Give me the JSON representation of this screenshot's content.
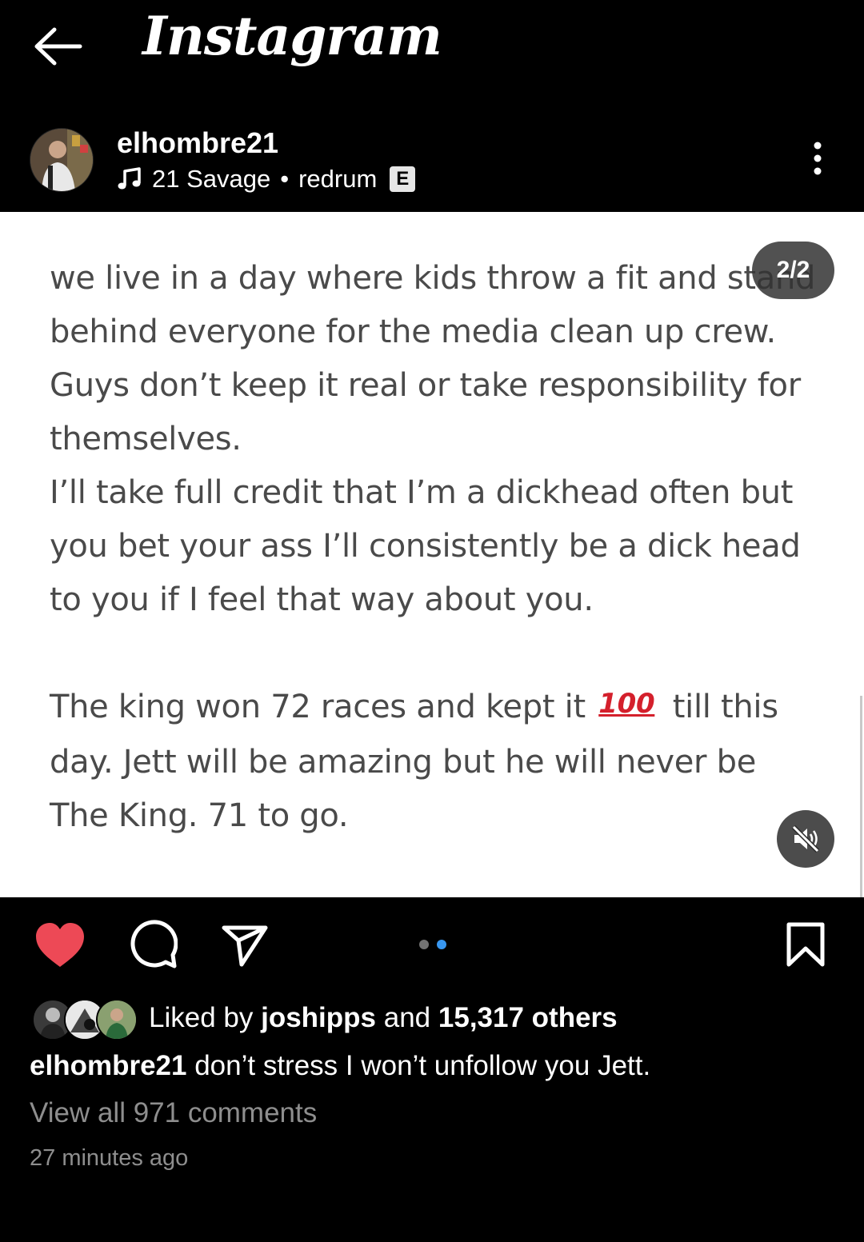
{
  "app": {
    "title": "Instagram"
  },
  "post": {
    "username": "elhombre21",
    "music": {
      "artist": "21 Savage",
      "separator": "•",
      "track": "redrum",
      "explicit_badge": "E"
    },
    "carousel": {
      "counter": "2/2",
      "current": 2,
      "total": 2
    },
    "image_text": {
      "lines_a": [
        "we live in a day where kids throw a fit and stand",
        "behind everyone for the media clean up crew.",
        "Guys don’t keep it real or take responsibility for",
        "themselves.",
        "I’ll take full credit that I’m a dickhead often but",
        "you bet your ass I’ll consistently be a dick head",
        "to you if I feel that way about you."
      ],
      "line_b1_before": "The king won 72 races and kept it",
      "emoji": "100",
      "line_b1_after": "till this",
      "line_b2": "day. Jett will be amazing but he will never be",
      "line_b3": "The King. 71 to go."
    },
    "likes": {
      "prefix": "Liked by",
      "user": "joshipps",
      "joiner": "and",
      "others": "15,317 others"
    },
    "caption": {
      "username": "elhombre21",
      "text": "don’t stress I won’t unfollow you Jett."
    },
    "view_comments": "View all 971 comments",
    "timestamp": "27 minutes ago"
  },
  "colors": {
    "like_red": "#ed4956",
    "dot_active": "#3897f0",
    "dot_inactive": "#737373",
    "secondary_text": "#8e8e8e",
    "hundred_red": "#d4202c"
  },
  "icons": [
    "back-arrow-icon",
    "music-note-icon",
    "more-vertical-icon",
    "heart-icon",
    "comment-icon",
    "share-icon",
    "bookmark-icon",
    "mute-icon"
  ]
}
